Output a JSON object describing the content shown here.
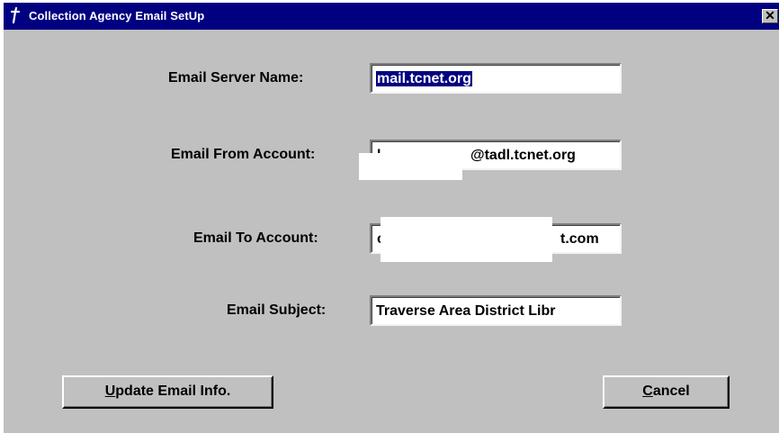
{
  "window": {
    "title": "Collection Agency Email SetUp",
    "app_icon": "dagger-icon",
    "close_label": "✕"
  },
  "form": {
    "server_name": {
      "label": "Email Server Name:",
      "value": "mail.tcnet.org"
    },
    "from_account": {
      "label": "Email From Account:",
      "value": "l…………@tadl.tcnet.org",
      "visible_suffix": "@tadl.tcnet.org"
    },
    "to_account": {
      "label": "Email To Account:",
      "value_prefix": "c",
      "visible_suffix": "t.com"
    },
    "subject": {
      "label": "Email Subject:",
      "value": "Traverse Area District Libr"
    }
  },
  "buttons": {
    "update": {
      "mnemonic": "U",
      "rest": "pdate Email Info."
    },
    "cancel": {
      "mnemonic": "C",
      "rest": "ancel"
    }
  },
  "colors": {
    "titlebar": "#000080",
    "face": "#c0c0c0",
    "selection": "#000080"
  }
}
